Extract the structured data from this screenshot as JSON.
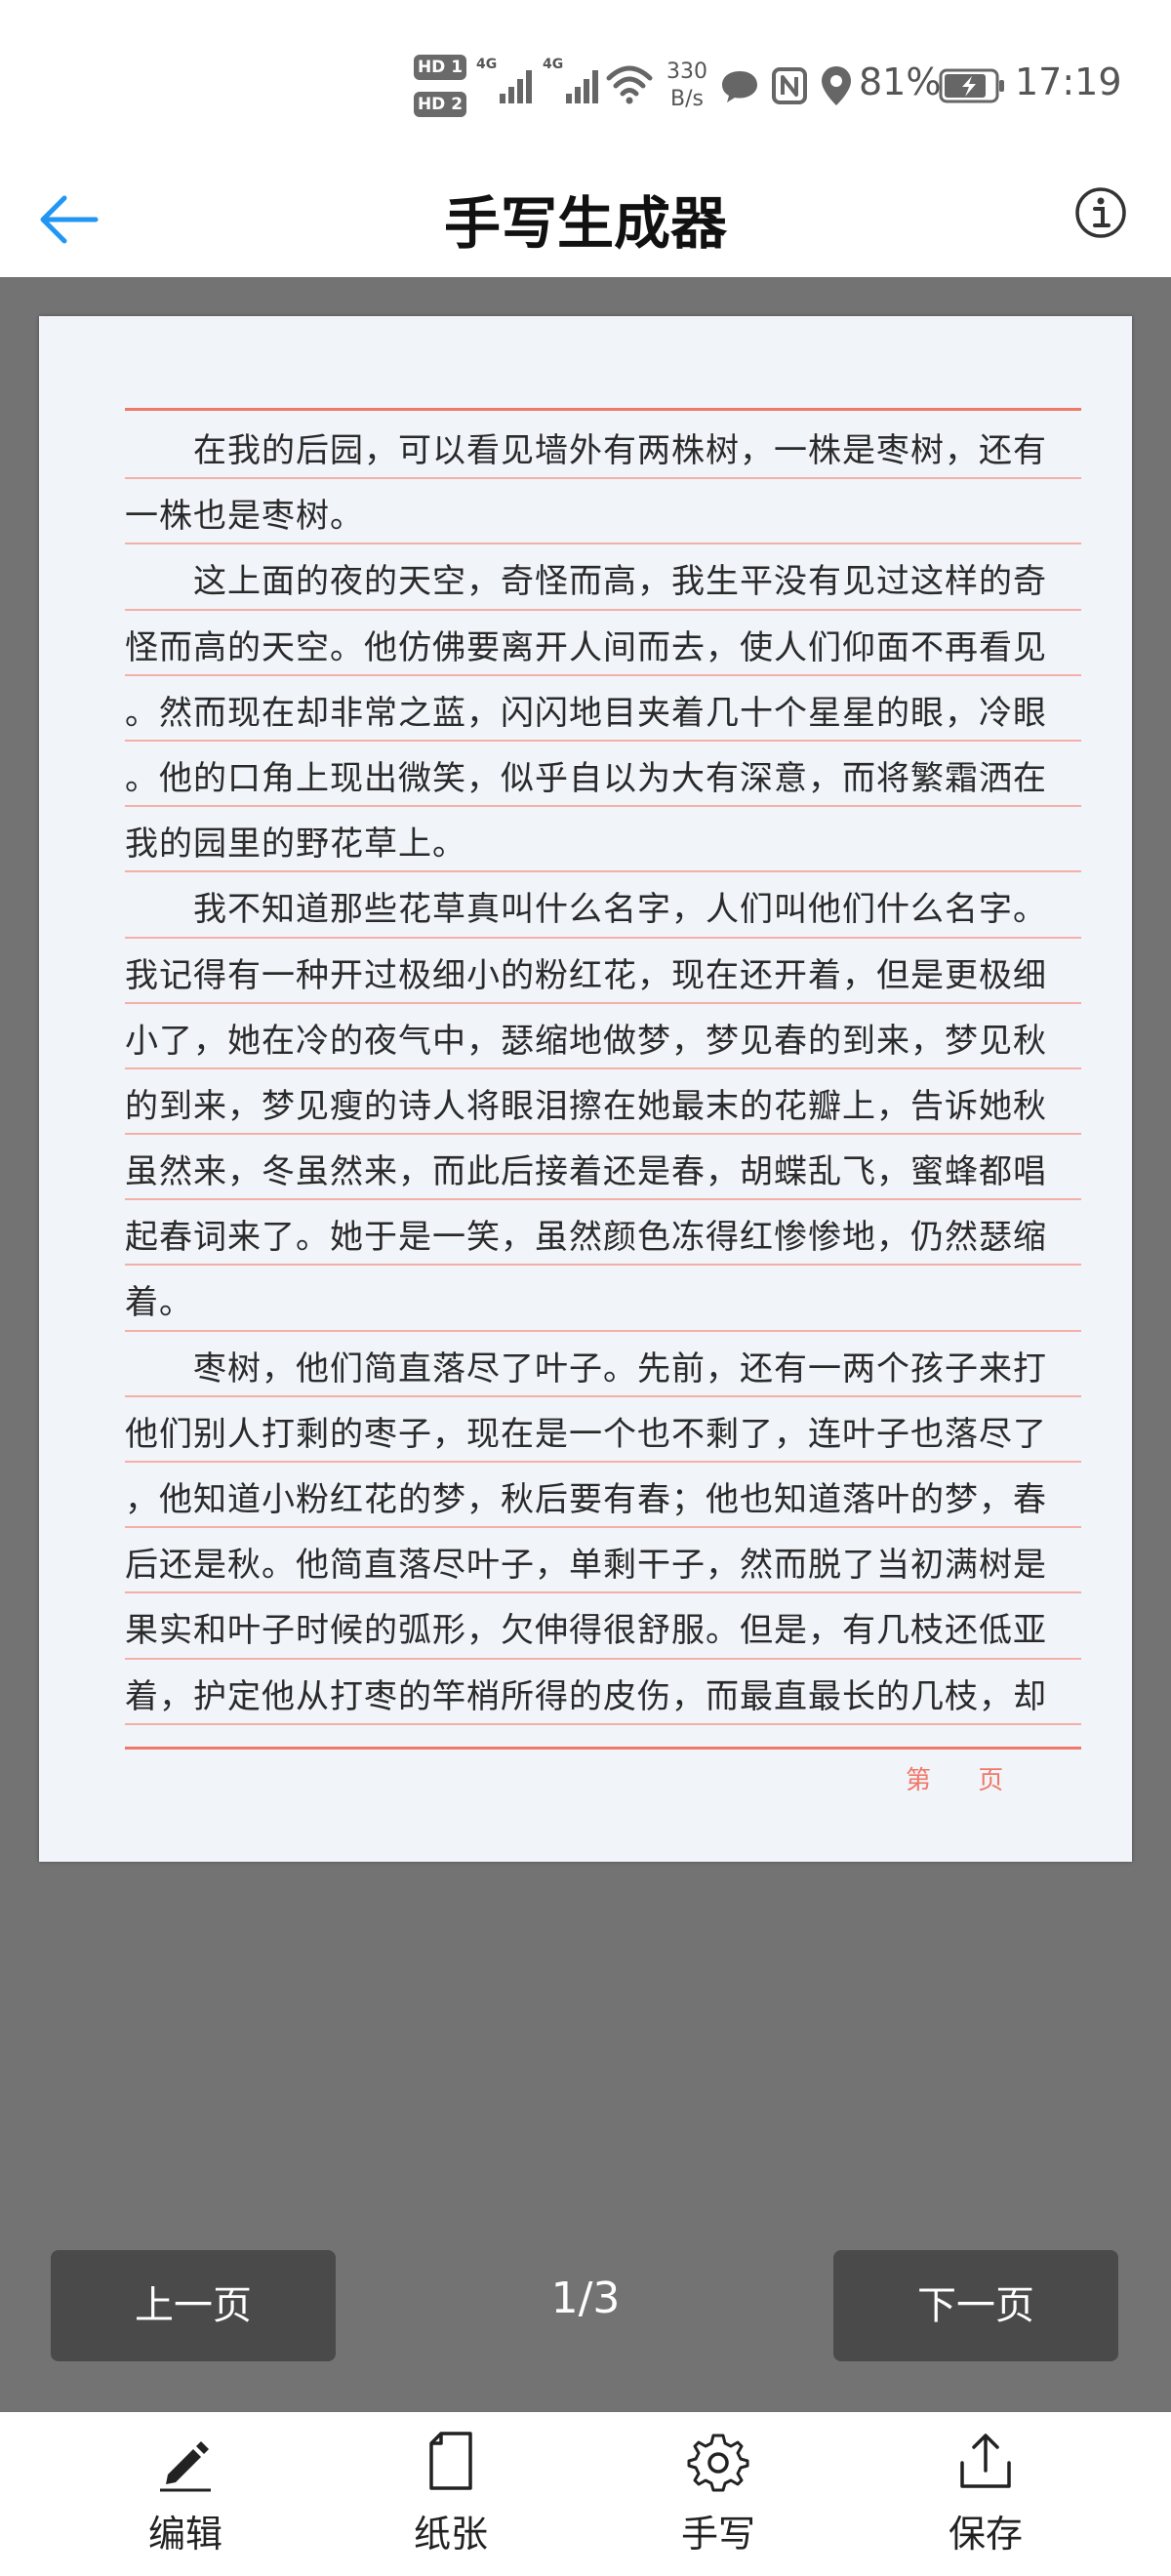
{
  "status_bar": {
    "sim1": "HD 1",
    "sim2": "HD 2",
    "signal_label": "4G",
    "net_speed_value": "330",
    "net_speed_unit": "B/s",
    "battery_percent": "81%",
    "time": "17:19"
  },
  "header": {
    "title": "手写生成器",
    "accent_color": "#2196f3"
  },
  "document": {
    "lines": [
      "　　在我的后园，可以看见墙外有两株树，一株是枣树，还有",
      "一株也是枣树。",
      "　　这上面的夜的天空，奇怪而高，我生平没有见过这样的奇",
      "怪而高的天空。他仿佛要离开人间而去，使人们仰面不再看见",
      "。然而现在却非常之蓝，闪闪地目夹着几十个星星的眼，冷眼",
      "。他的口角上现出微笑，似乎自以为大有深意，而将繁霜洒在",
      "我的园里的野花草上。",
      "　　我不知道那些花草真叫什么名字，人们叫他们什么名字。",
      "我记得有一种开过极细小的粉红花，现在还开着，但是更极细",
      "小了，她在冷的夜气中，瑟缩地做梦，梦见春的到来，梦见秋",
      "的到来，梦见瘦的诗人将眼泪擦在她最末的花瓣上，告诉她秋",
      "虽然来，冬虽然来，而此后接着还是春，胡蝶乱飞，蜜蜂都唱",
      "起春词来了。她于是一笑，虽然颜色冻得红惨惨地，仍然瑟缩",
      "着。",
      "　　枣树，他们简直落尽了叶子。先前，还有一两个孩子来打",
      "他们别人打剩的枣子，现在是一个也不剩了，连叶子也落尽了",
      "，他知道小粉红花的梦，秋后要有春；他也知道落叶的梦，春",
      "后还是秋。他简直落尽叶子，单剩干子，然而脱了当初满树是",
      "果实和叶子时候的弧形，欠伸得很舒服。但是，有几枝还低亚",
      "着，护定他从打枣的竿梢所得的皮伤，而最直最长的几枝，却"
    ],
    "footer_page": "第",
    "footer_page_suffix": "页",
    "rule_color": "#f07868"
  },
  "pager": {
    "prev_label": "上一页",
    "next_label": "下一页",
    "indicator": "1/3"
  },
  "tabs": [
    {
      "label": "编辑",
      "icon": "edit-icon"
    },
    {
      "label": "纸张",
      "icon": "paper-icon"
    },
    {
      "label": "手写",
      "icon": "gear-icon"
    },
    {
      "label": "保存",
      "icon": "share-icon"
    }
  ]
}
